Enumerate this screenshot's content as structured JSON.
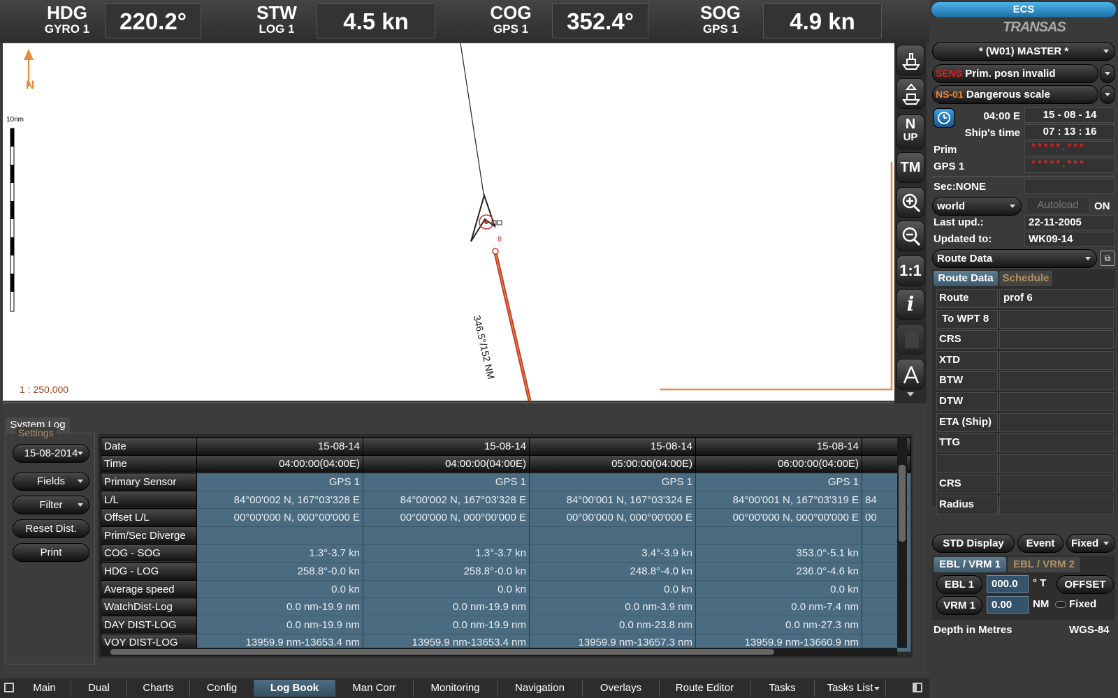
{
  "header": {
    "hdg_label": "HDG",
    "hdg_src": "GYRO 1",
    "hdg_val": "220.2°",
    "stw_label": "STW",
    "stw_src": "LOG 1",
    "stw_val": "4.5 kn",
    "cog_label": "COG",
    "cog_src": "GPS 1",
    "cog_val": "352.4°",
    "sog_label": "SOG",
    "sog_src": "GPS 1",
    "sog_val": "4.9 kn"
  },
  "map": {
    "north_label": "N",
    "scalebar_label": "10nm",
    "scale": "1 : 250,000",
    "waypoint_label": "8",
    "leg_label": "346.5°/152 NM"
  },
  "tools": {
    "nup_top": "N",
    "nup_bottom": "UP",
    "tm": "TM",
    "one_to_one": "1:1",
    "info": "i"
  },
  "rpanel": {
    "brand_top": "ECS",
    "brand": "TRANSAS",
    "master": "* (W01) MASTER *",
    "sens_code": "SENS",
    "sens_text": "Prim. posn invalid",
    "ns_code": "NS-01",
    "ns_text": "Dangerous scale",
    "tz": "04:00 E",
    "date": "15 - 08 - 14",
    "ships_time_label": "Ship's time",
    "ships_time": "07 : 13 : 16",
    "prim_label": "Prim",
    "prim_val": "*****.***",
    "gps_label": "GPS 1",
    "gps_val": "*****.***",
    "sec_label": "Sec:NONE",
    "chart_folio": "world",
    "autoload": "Autoload",
    "autoload_state": "ON",
    "last_upd_label": "Last upd.:",
    "last_upd": "22-11-2005",
    "updated_to_label": "Updated to:",
    "updated_to": "WK09-14",
    "route_data_select": "Route Data",
    "tab_route_data": "Route Data",
    "tab_schedule": "Schedule",
    "route_rows": [
      {
        "label": "Route",
        "value": "prof 6"
      },
      {
        "label": "To WPT 8",
        "value": ""
      },
      {
        "label": "CRS",
        "value": ""
      },
      {
        "label": "XTD",
        "value": ""
      },
      {
        "label": "BTW",
        "value": ""
      },
      {
        "label": "DTW",
        "value": ""
      },
      {
        "label": "ETA (Ship)",
        "value": ""
      },
      {
        "label": "TTG",
        "value": ""
      },
      {
        "label": "",
        "value": ""
      },
      {
        "label": "CRS",
        "value": ""
      },
      {
        "label": "Radius",
        "value": ""
      }
    ],
    "std_display": "STD Display",
    "event": "Event",
    "fixed_select": "Fixed",
    "tab_ebl1": "EBL / VRM 1",
    "tab_ebl2": "EBL / VRM 2",
    "ebl_btn": "EBL 1",
    "ebl_val": "000.0",
    "ebl_unit": "° T",
    "offset_btn": "OFFSET",
    "vrm_btn": "VRM 1",
    "vrm_val": "0.00",
    "vrm_unit": "NM",
    "fixed_label": "Fixed",
    "depth": "Depth in Metres",
    "datum": "WGS-84"
  },
  "log": {
    "panel_tab": "System Log",
    "settings": "Settings",
    "date_select": "15-08-2014",
    "fields": "Fields",
    "filter": "Filter",
    "reset": "Reset Dist.",
    "print": "Print",
    "rows": [
      {
        "h": "Date",
        "c": [
          "15-08-14",
          "15-08-14",
          "15-08-14",
          "15-08-14",
          ""
        ],
        "dark": true
      },
      {
        "h": "Time",
        "c": [
          "04:00:00(04:00E)",
          "04:00:00(04:00E)",
          "05:00:00(04:00E)",
          "06:00:00(04:00E)",
          ""
        ],
        "dark": true
      },
      {
        "h": "Primary Sensor",
        "c": [
          "GPS 1",
          "GPS 1",
          "GPS 1",
          "GPS 1",
          ""
        ]
      },
      {
        "h": "L/L",
        "c": [
          "84°00'002 N, 167°03'328 E",
          "84°00'002 N, 167°03'328 E",
          "84°00'001 N, 167°03'324 E",
          "84°00'001 N, 167°03'319 E",
          "84"
        ]
      },
      {
        "h": "Offset L/L",
        "c": [
          "00°00'000 N, 000°00'000 E",
          "00°00'000 N, 000°00'000 E",
          "00°00'000 N, 000°00'000 E",
          "00°00'000 N, 000°00'000 E",
          "00"
        ]
      },
      {
        "h": "Prim/Sec Diverge",
        "c": [
          "",
          "",
          "",
          "",
          ""
        ]
      },
      {
        "h": "COG - SOG",
        "c": [
          "1.3°-3.7 kn",
          "1.3°-3.7 kn",
          "3.4°-3.9 kn",
          "353.0°-5.1 kn",
          ""
        ]
      },
      {
        "h": "HDG - LOG",
        "c": [
          "258.8°-0.0 kn",
          "258.8°-0.0 kn",
          "248.8°-4.0 kn",
          "236.0°-4.6 kn",
          ""
        ]
      },
      {
        "h": "Average speed",
        "c": [
          "0.0 kn",
          "0.0 kn",
          "0.0 kn",
          "0.0 kn",
          ""
        ]
      },
      {
        "h": "WatchDist-Log",
        "c": [
          "0.0 nm-19.9 nm",
          "0.0 nm-19.9 nm",
          "0.0 nm-3.9 nm",
          "0.0 nm-7.4 nm",
          ""
        ]
      },
      {
        "h": "DAY DIST-LOG",
        "c": [
          "0.0 nm-19.9 nm",
          "0.0 nm-19.9 nm",
          "0.0 nm-23.8 nm",
          "0.0 nm-27.3 nm",
          ""
        ]
      },
      {
        "h": "VOY DIST-LOG",
        "c": [
          "13959.9 nm-13653.4 nm",
          "13959.9 nm-13653.4 nm",
          "13959.9 nm-13657.3 nm",
          "13959.9 nm-13660.9 nm",
          ""
        ]
      }
    ]
  },
  "tabs": [
    "Main",
    "Dual",
    "Charts",
    "Config",
    "Log Book",
    "Man Corr",
    "Monitoring",
    "Navigation",
    "Overlays",
    "Route Editor",
    "Tasks",
    "Tasks List"
  ],
  "active_tab": "Log Book",
  "colors": {
    "accent_orange": "#e8893a",
    "route_red": "#c0392b",
    "alarm_red": "#e02020",
    "grid_blue": "#4b6b80",
    "brand_blue": "#1d88c6"
  }
}
